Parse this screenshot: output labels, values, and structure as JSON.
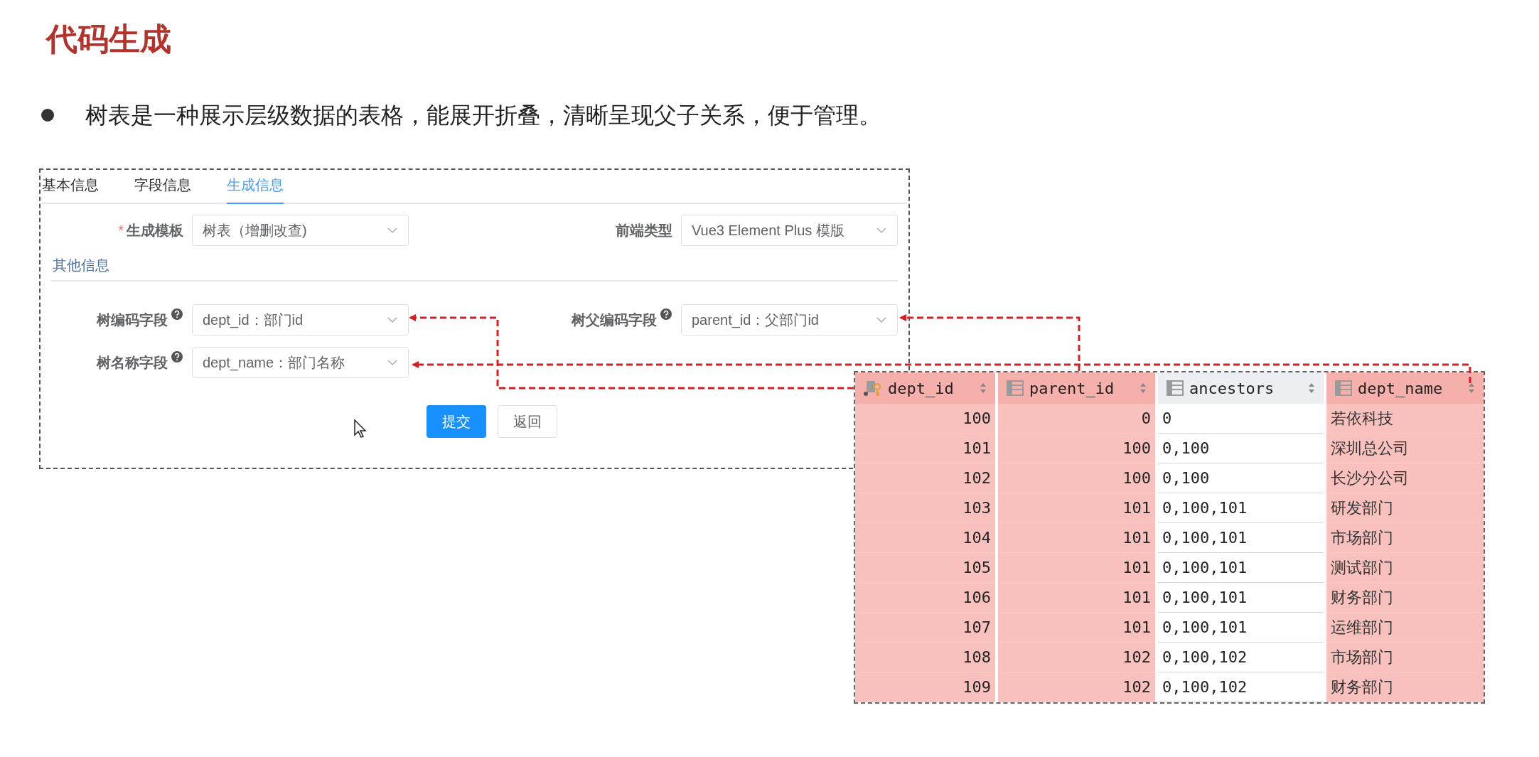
{
  "slide": {
    "title": "代码生成",
    "bullets": [
      "树表是一种展示层级数据的表格，能展开折叠，清晰呈现父子关系，便于管理。"
    ]
  },
  "form": {
    "tabs": [
      {
        "label": "基本信息",
        "selected": false
      },
      {
        "label": "字段信息",
        "selected": false
      },
      {
        "label": "生成信息",
        "selected": true
      }
    ],
    "top_fields": [
      {
        "label": "生成模板",
        "required_mark": "*",
        "help": false,
        "value": "树表（增删改查)"
      },
      {
        "label": "前端类型",
        "help": false,
        "value": "Vue3 Element Plus 模版"
      }
    ],
    "section_title": "其他信息",
    "tree_fields": [
      {
        "label": "树编码字段",
        "help": true,
        "value": "dept_id：部门id"
      },
      {
        "label": "树父编码字段",
        "help": true,
        "value": "parent_id：父部门id"
      },
      {
        "label": "树名称字段",
        "help": true,
        "value": "dept_name：部门名称"
      }
    ],
    "buttons": [
      {
        "label": "提交",
        "kind": "primary"
      },
      {
        "label": "返回",
        "kind": "default"
      }
    ]
  },
  "table": {
    "columns": [
      {
        "name": "dept_id",
        "key": true,
        "highlighted": true,
        "kind": "number"
      },
      {
        "name": "parent_id",
        "key": false,
        "highlighted": true,
        "kind": "number"
      },
      {
        "name": "ancestors",
        "key": false,
        "highlighted": false,
        "kind": "text"
      },
      {
        "name": "dept_name",
        "key": false,
        "highlighted": true,
        "kind": "text"
      }
    ],
    "rows": [
      [
        "100",
        "0",
        "0",
        "若依科技"
      ],
      [
        "101",
        "100",
        "0,100",
        "深圳总公司"
      ],
      [
        "102",
        "100",
        "0,100",
        "长沙分公司"
      ],
      [
        "103",
        "101",
        "0,100,101",
        "研发部门"
      ],
      [
        "104",
        "101",
        "0,100,101",
        "市场部门"
      ],
      [
        "105",
        "101",
        "0,100,101",
        "测试部门"
      ],
      [
        "106",
        "101",
        "0,100,101",
        "财务部门"
      ],
      [
        "107",
        "101",
        "0,100,101",
        "运维部门"
      ],
      [
        "108",
        "102",
        "0,100,102",
        "市场部门"
      ],
      [
        "109",
        "102",
        "0,100,102",
        "财务部门"
      ]
    ]
  }
}
